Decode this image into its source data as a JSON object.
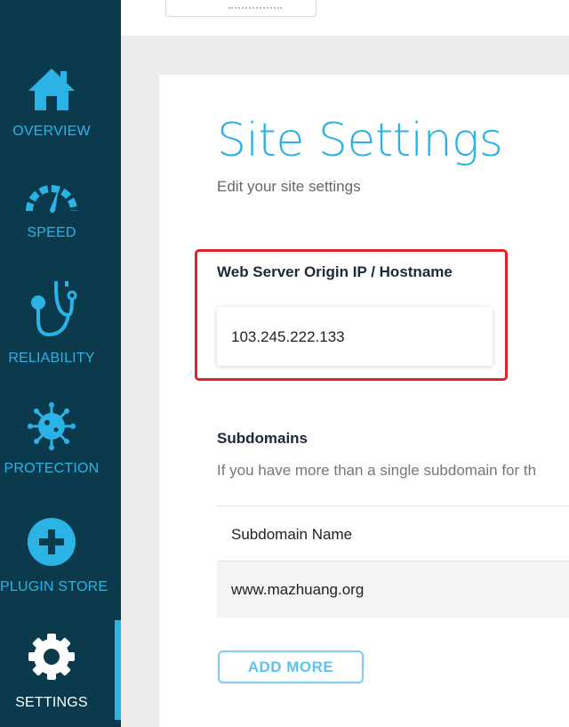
{
  "sidebar": {
    "items": [
      {
        "label": "OVERVIEW",
        "icon": "home-icon"
      },
      {
        "label": "SPEED",
        "icon": "speedometer-icon"
      },
      {
        "label": "RELIABILITY",
        "icon": "stethoscope-icon"
      },
      {
        "label": "PROTECTION",
        "icon": "virus-icon"
      },
      {
        "label": "PLUGIN STORE",
        "icon": "plus-circle-icon"
      },
      {
        "label": "SETTINGS",
        "icon": "gear-icon",
        "active": true
      }
    ]
  },
  "page": {
    "title": "Site Settings",
    "subtitle": "Edit your site settings"
  },
  "origin": {
    "label": "Web Server Origin IP / Hostname",
    "value": "103.245.222.133"
  },
  "subdomains": {
    "label": "Subdomains",
    "description": "If you have more than a single subdomain for th",
    "column_header": "Subdomain Name",
    "rows": [
      "www.mazhuang.org"
    ],
    "add_more_label": "ADD MORE"
  },
  "colors": {
    "sidebar_bg": "#0b3a4c",
    "accent": "#2bb3e6",
    "highlight": "#e4202b"
  }
}
